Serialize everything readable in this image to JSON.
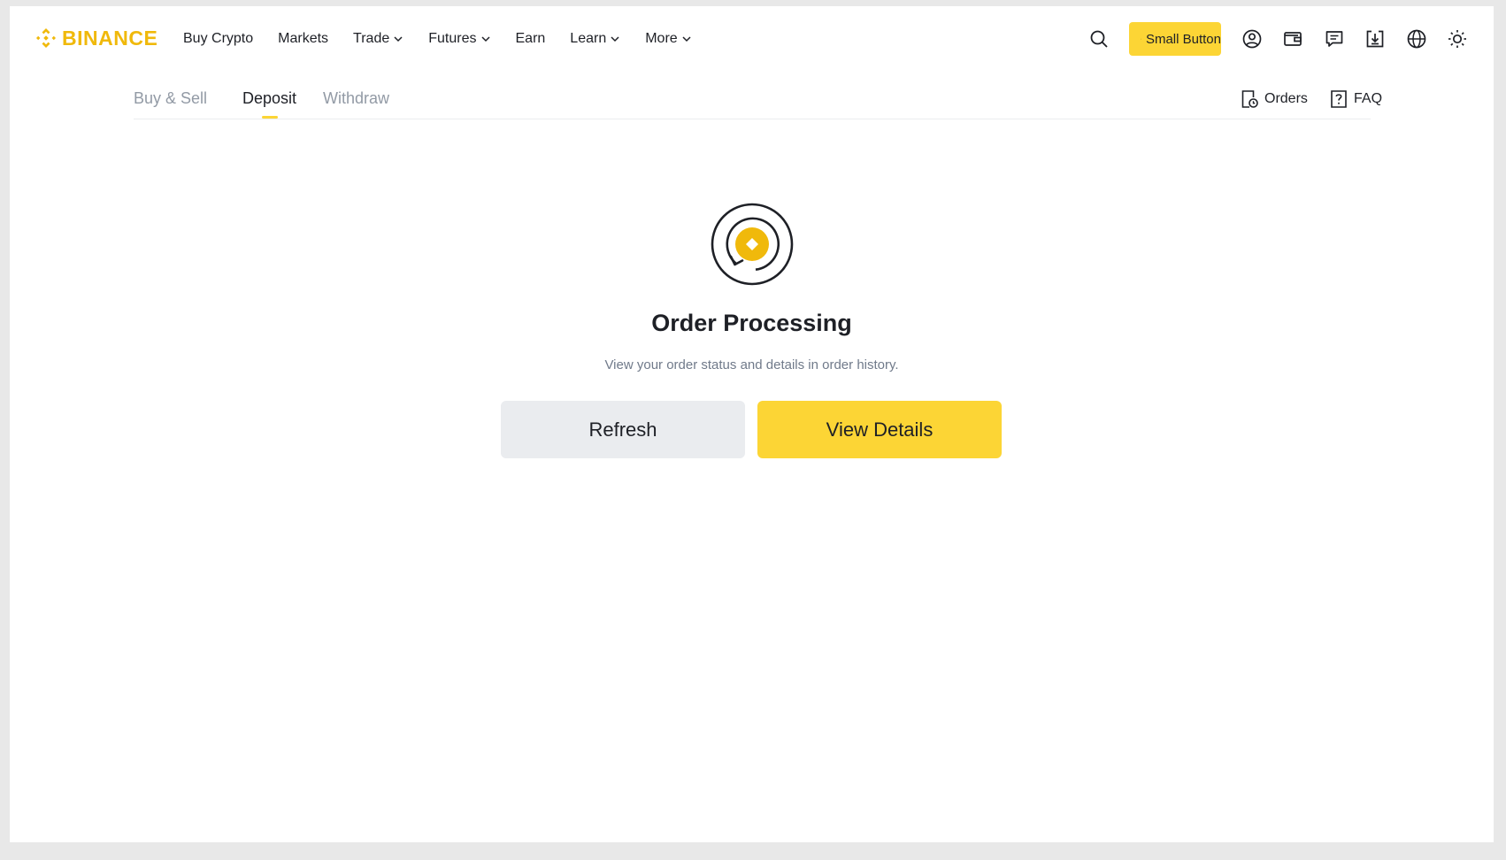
{
  "brand": {
    "name": "BINANCE",
    "color": "#f0b90b"
  },
  "nav": {
    "items": [
      {
        "label": "Buy Crypto",
        "dropdown": false
      },
      {
        "label": "Markets",
        "dropdown": false
      },
      {
        "label": "Trade",
        "dropdown": true
      },
      {
        "label": "Futures",
        "dropdown": true
      },
      {
        "label": "Earn",
        "dropdown": false
      },
      {
        "label": "Learn",
        "dropdown": true
      },
      {
        "label": "More",
        "dropdown": true
      }
    ]
  },
  "toolbar": {
    "download_label": "Small Button",
    "icons": [
      "search-icon",
      "download-icon",
      "user-icon",
      "wallet-icon",
      "messages-icon",
      "download-app-icon",
      "globe-icon",
      "theme-sun-icon"
    ]
  },
  "subnav": {
    "tabs": [
      {
        "label": "Buy & Sell",
        "active": false
      },
      {
        "label": "Deposit",
        "active": true
      },
      {
        "label": "Withdraw",
        "active": false
      }
    ],
    "orders_label": "Orders",
    "faq_label": "FAQ"
  },
  "status": {
    "title": "Order Processing",
    "description": "View your order status and details in order history.",
    "refresh_label": "Refresh",
    "view_details_label": "View Details"
  },
  "colors": {
    "accent": "#fcd535",
    "brand": "#f0b90b",
    "text": "#1e2026",
    "muted": "#929aa5",
    "secondary_button": "#eaecef"
  }
}
